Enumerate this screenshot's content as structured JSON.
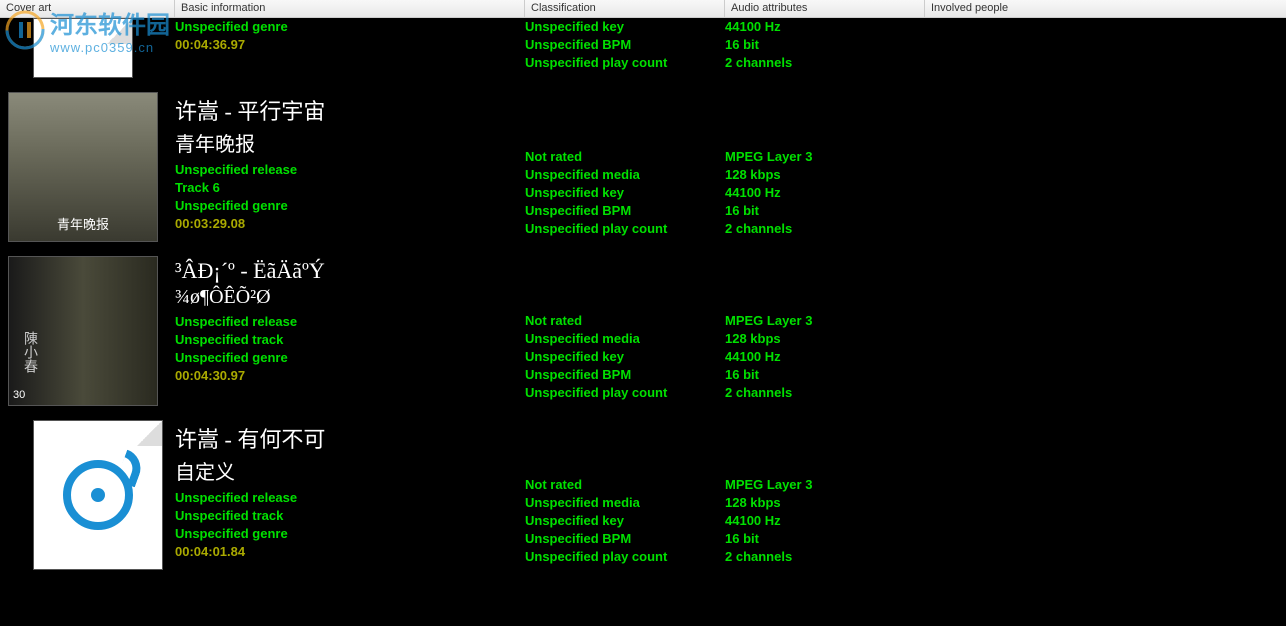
{
  "watermark": {
    "text": "河东软件园",
    "url": "www.pc0359.cn"
  },
  "headers": {
    "cover": "Cover art",
    "basic": "Basic information",
    "classification": "Classification",
    "audio": "Audio attributes",
    "people": "Involved people"
  },
  "tracks": [
    {
      "cover_type": "partial",
      "title": "",
      "album": "",
      "release": "Unspecified genre",
      "track": "",
      "genre": "",
      "duration": "00:04:36.97",
      "rating": "Unspecified key",
      "media": "Unspecified BPM",
      "key": "Unspecified play count",
      "bpm": "",
      "playcount": "",
      "format": "44100 Hz",
      "bitrate": "16 bit",
      "samplerate": "2 channels",
      "bitdepth": "",
      "channels": ""
    },
    {
      "cover_type": "photo1",
      "cover_text": "青年晚报",
      "title": "许嵩 - 平行宇宙",
      "album": "青年晚报",
      "release": "Unspecified release",
      "track": "Track 6",
      "genre": "Unspecified genre",
      "duration": "00:03:29.08",
      "rating": "Not rated",
      "media": "Unspecified media",
      "key": "Unspecified key",
      "bpm": "Unspecified BPM",
      "playcount": "Unspecified play count",
      "format": "MPEG Layer 3",
      "bitrate": "128 kbps",
      "samplerate": "44100 Hz",
      "bitdepth": "16 bit",
      "channels": "2 channels"
    },
    {
      "cover_type": "photo2",
      "cover_text": "陳小春",
      "cover_subtext": "30",
      "title": "³ÂÐ¡´º - ËãÄãºÝ",
      "album": "¾ø¶ÔÊÕ²Ø",
      "release": "Unspecified release",
      "track": "Unspecified track",
      "genre": "Unspecified genre",
      "duration": "00:04:30.97",
      "rating": "Not rated",
      "media": "Unspecified media",
      "key": "Unspecified key",
      "bpm": "Unspecified BPM",
      "playcount": "Unspecified play count",
      "format": "MPEG Layer 3",
      "bitrate": "128 kbps",
      "samplerate": "44100 Hz",
      "bitdepth": "16 bit",
      "channels": "2 channels"
    },
    {
      "cover_type": "default",
      "title": "许嵩 - 有何不可",
      "album": "自定义",
      "release": "Unspecified release",
      "track": "Unspecified track",
      "genre": "Unspecified genre",
      "duration": "00:04:01.84",
      "rating": "Not rated",
      "media": "Unspecified media",
      "key": "Unspecified key",
      "bpm": "Unspecified BPM",
      "playcount": "Unspecified play count",
      "format": "MPEG Layer 3",
      "bitrate": "128 kbps",
      "samplerate": "44100 Hz",
      "bitdepth": "16 bit",
      "channels": "2 channels"
    }
  ]
}
